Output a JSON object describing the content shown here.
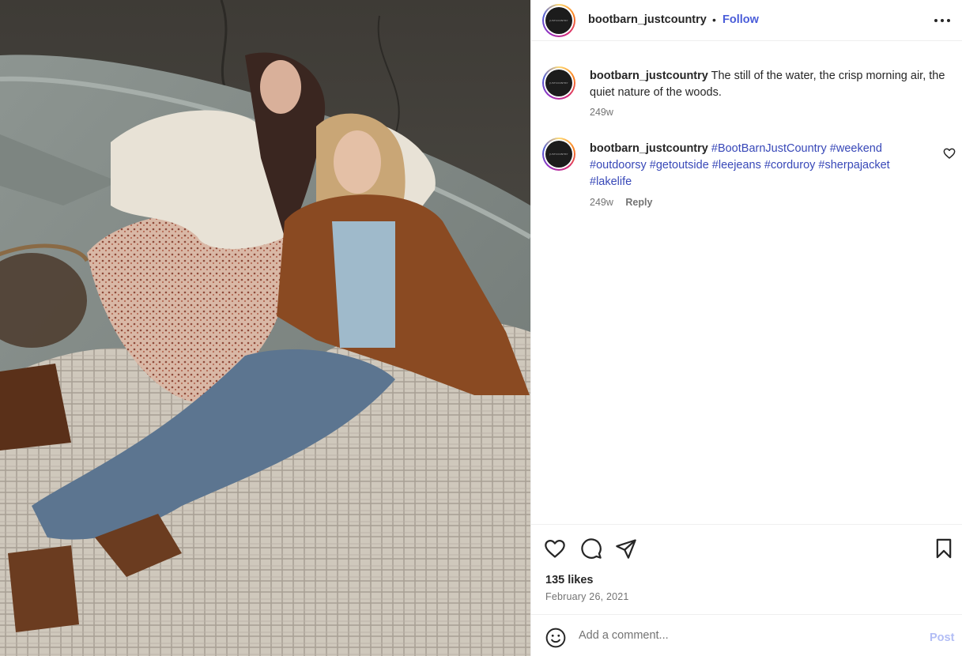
{
  "post": {
    "image_alt": "Two women reclining in a rowboat on a lake",
    "avatar_text": "JUSTCOUNTRY"
  },
  "header": {
    "username": "bootbarn_justcountry",
    "separator": "•",
    "follow_label": "Follow",
    "more_icon": "more-horizontal-icon"
  },
  "comments": [
    {
      "username": "bootbarn_justcountry",
      "text": "The still of the water, the crisp morning air, the quiet nature of the woods.",
      "age": "249w"
    },
    {
      "username": "bootbarn_justcountry",
      "hashtags": [
        "#BootBarnJustCountry",
        "#weekend",
        "#outdoorsy",
        "#getoutside",
        "#leejeans",
        "#corduroy",
        "#sherpajacket",
        "#lakelife"
      ],
      "age": "249w",
      "reply_label": "Reply"
    }
  ],
  "actions": {
    "likes": "135 likes",
    "date": "February 26, 2021"
  },
  "add_comment": {
    "placeholder": "Add a comment...",
    "post_label": "Post"
  },
  "colors": {
    "link_blue": "#4a5dd9",
    "hashtag_blue": "#3848b8",
    "post_disabled": "#b2bdf5",
    "muted": "#737373"
  }
}
